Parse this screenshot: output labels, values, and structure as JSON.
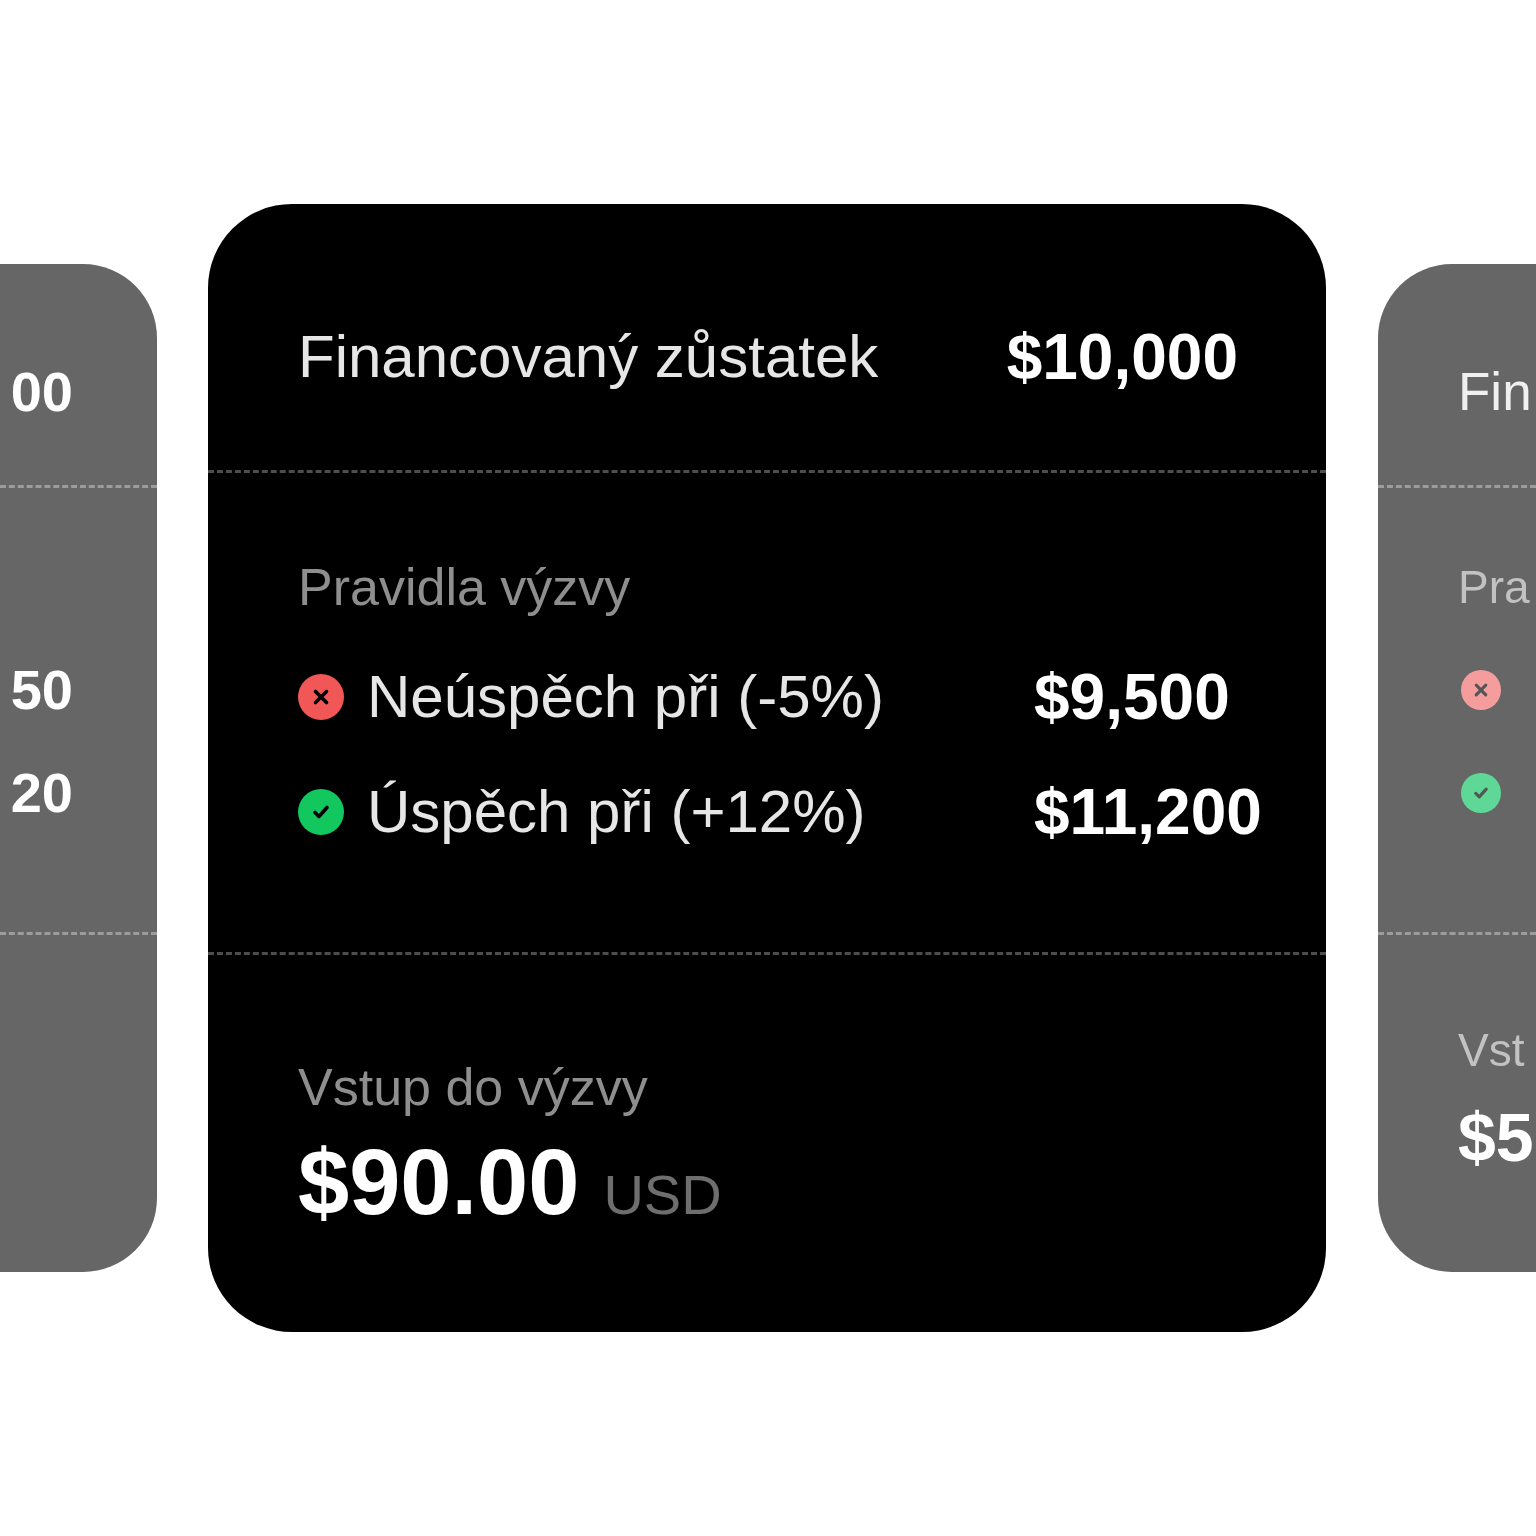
{
  "carousel": [
    {
      "active": false,
      "balance": {
        "value": "00"
      },
      "rules": [
        {
          "value": "50"
        },
        {
          "value": "20"
        }
      ]
    },
    {
      "active": true,
      "balance": {
        "label": "Financovaný zůstatek",
        "value": "$10,000"
      },
      "rules_title": "Pravidla výzvy",
      "rules": [
        {
          "kind": "fail",
          "label": "Neúspěch při (-5%)",
          "value": "$9,500"
        },
        {
          "kind": "pass",
          "label": "Úspěch při (+12%)",
          "value": "$11,200"
        }
      ],
      "entry": {
        "label": "Vstup do výzvy",
        "price": "$90.00",
        "currency": "USD"
      }
    },
    {
      "active": false,
      "balance": {
        "label": "Fin"
      },
      "rules_title": "Pra",
      "rules": [
        {
          "kind": "fail"
        },
        {
          "kind": "pass"
        }
      ],
      "entry": {
        "label": "Vst",
        "price": "$5"
      }
    }
  ]
}
